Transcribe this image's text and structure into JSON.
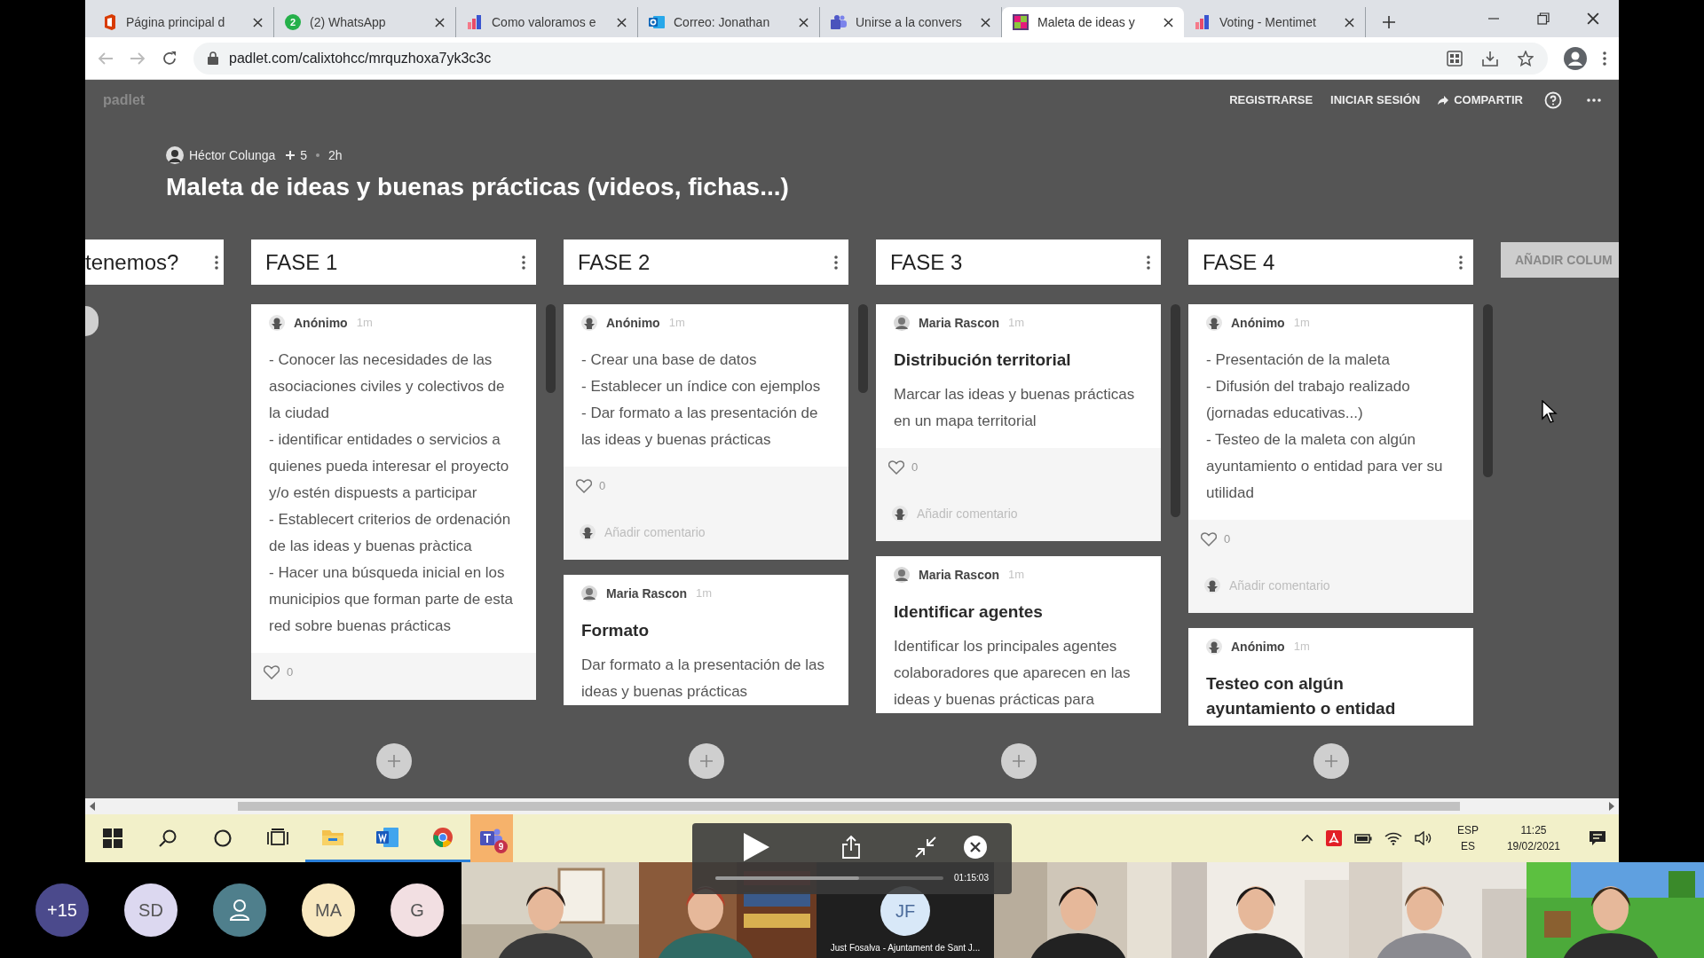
{
  "browser": {
    "tabs": [
      {
        "kind": "office",
        "title": "Página principal d",
        "selected": false
      },
      {
        "kind": "whatsapp",
        "badge": "2",
        "title": "(2) WhatsApp",
        "selected": false
      },
      {
        "kind": "chart",
        "title": "Como valoramos e",
        "selected": false
      },
      {
        "kind": "mail",
        "title": "Correo: Jonathan",
        "selected": false
      },
      {
        "kind": "teams",
        "title": "Unirse a la convers",
        "selected": false
      },
      {
        "kind": "padlet",
        "title": "Maleta de ideas y",
        "selected": true
      },
      {
        "kind": "chart",
        "title": "Voting - Mentimet",
        "selected": false
      }
    ],
    "url": "padlet.com/calixtohcc/mrquzhoxa7yk3c3c"
  },
  "padlet": {
    "logo": "padlet",
    "actions": [
      "REGISTRARSE",
      "INICIAR SESIÓN",
      "COMPARTIR"
    ],
    "author": "Héctor Colunga",
    "count": "5",
    "age": "2h",
    "title": "Maleta de ideas y buenas prácticas (videos, fichas...)",
    "columns": [
      {
        "title": "tenemos?",
        "partial": true
      },
      {
        "title": "FASE 1",
        "partial": false,
        "posts": [
          {
            "kind": "anonymous",
            "author": "Anónimo",
            "time": "1m",
            "body": [
              "- Conocer las necesidades de las asociaciones civiles y colectivos de la ciudad",
              "- identificar entidades o servicios a quienes pueda interesar el proyecto y/o estén dispuests a participar",
              "- Establecert criterios de ordenación de las ideas y buenas pràctica",
              "- Hacer una búsqueda inicial en los municipios que forman parte de esta red sobre buenas prácticas"
            ],
            "likes": "0"
          }
        ]
      },
      {
        "title": "FASE 2",
        "partial": false,
        "posts": [
          {
            "kind": "anonymous",
            "author": "Anónimo",
            "time": "1m",
            "body": [
              "- Crear una base de datos",
              "- Establecer un índice con ejemplos",
              "- Dar formato a las presentación de las ideas y buenas prácticas"
            ],
            "likes": "0",
            "comment_placeholder": "Añadir comentario"
          },
          {
            "author": "Maria Rascon",
            "time": "1m",
            "title": "Formato",
            "body": [
              "Dar formato a la presentación de las ideas y buenas prácticas"
            ]
          }
        ]
      },
      {
        "title": "FASE 3",
        "partial": false,
        "posts": [
          {
            "author": "Maria Rascon",
            "time": "1m",
            "title": "Distribución territorial",
            "body": [
              "Marcar las ideas y buenas prácticas en un mapa territorial"
            ],
            "likes": "0",
            "comment_placeholder": "Añadir comentario"
          },
          {
            "author": "Maria Rascon",
            "time": "1m",
            "title": "Identificar agentes",
            "body": [
              "Identificar los principales agentes colaboradores que aparecen en las ideas y buenas prácticas para"
            ]
          }
        ]
      },
      {
        "title": "FASE 4",
        "partial": false,
        "posts": [
          {
            "kind": "anonymous",
            "author": "Anónimo",
            "time": "1m",
            "body": [
              "- Presentación de la maleta",
              "- Difusión del trabajo realizado (jornadas educativas...)",
              "- Testeo de la maleta con algún ayuntamiento o entidad para ver su utilidad"
            ],
            "likes": "0",
            "comment_placeholder": "Añadir comentario"
          },
          {
            "kind": "anonymous",
            "author": "Anónimo",
            "time": "1m",
            "title": "Testeo con algún ayuntamiento o entidad"
          }
        ]
      }
    ],
    "add_column": "AÑADIR COLUM"
  },
  "taskbar": {
    "teams_badge": "9",
    "language": [
      "ESP",
      "ES"
    ],
    "time": "11:25",
    "date": "19/02/2021"
  },
  "player": {
    "time": "01:15:03",
    "level": 0.63
  },
  "participants": [
    {
      "kind": "initials",
      "initials": "+15",
      "color": "#4b4a8c"
    },
    {
      "kind": "initials",
      "initials": "SD",
      "color": "#dcd8f0"
    },
    {
      "kind": "icon",
      "color": "#4f7f8c"
    },
    {
      "kind": "initials",
      "initials": "MA",
      "color": "#f8e8c0"
    },
    {
      "kind": "initials",
      "initials": "G",
      "color": "#f2dfe2"
    }
  ],
  "videos": [
    {
      "kind": "picture"
    },
    {
      "kind": "picture"
    },
    {
      "kind": "avatar",
      "initials": "JF",
      "name": "Just Fosalva - Ajuntament de Sant J..."
    },
    {
      "kind": "picture"
    },
    {
      "kind": "picture"
    },
    {
      "kind": "picture"
    },
    {
      "kind": "picture"
    }
  ]
}
